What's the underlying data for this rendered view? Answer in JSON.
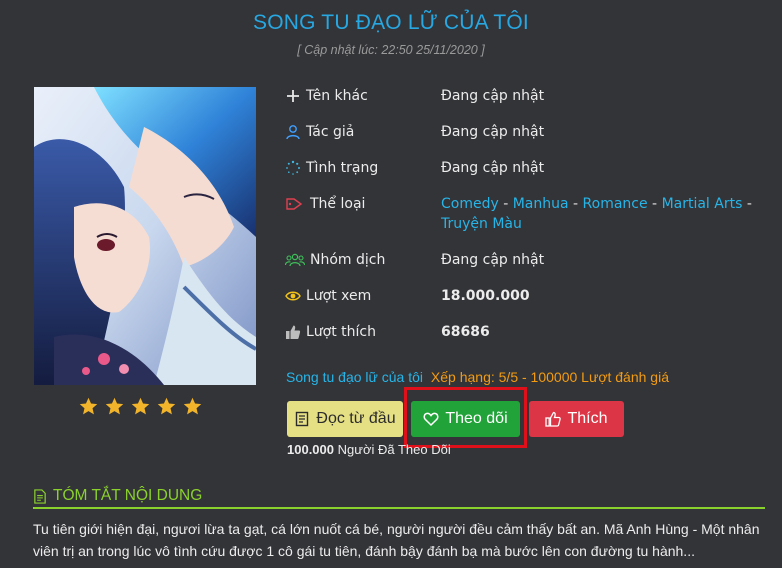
{
  "title": "SONG TU ĐẠO LỮ CỦA TÔI",
  "updated": "[ Cập nhật lúc: 22:50 25/11/2020 ]",
  "rating_stars": 5,
  "info": [
    {
      "icon": "plus-icon",
      "label": "Tên khác",
      "value": "Đang cập nhật"
    },
    {
      "icon": "user-icon",
      "label": "Tác giả",
      "value": "Đang cập nhật"
    },
    {
      "icon": "spinner-icon",
      "label": "Tình trạng",
      "value": "Đang cập nhật"
    },
    {
      "icon": "tag-icon",
      "label": "Thể loại"
    },
    {
      "icon": "group-icon",
      "label": "Nhóm dịch",
      "value": "Đang cập nhật"
    },
    {
      "icon": "eye-icon",
      "label": "Lượt xem",
      "value": "18.000.000"
    },
    {
      "icon": "thumbs-up-icon",
      "label": "Lượt thích",
      "value": "68686"
    }
  ],
  "genres": [
    "Comedy",
    "Manhua",
    "Romance",
    "Martial Arts",
    "Truyện Màu"
  ],
  "genre_separator": " - ",
  "rating": {
    "title_link": "Song tu đạo lữ của tôi",
    "rank_text": "Xếp hạng: 5/5 - 100000 Lượt đánh giá"
  },
  "buttons": {
    "read": "Đọc từ đầu",
    "follow": "Theo dõi",
    "like": "Thích"
  },
  "followers": {
    "count": "100.000",
    "label": "Người Đã Theo Dõi"
  },
  "summary": {
    "heading": "TÓM TẮT NỘI DUNG",
    "text": "Tu tiên giới hiện đại, ngươi lừa ta gạt, cá lớn nuốt cá bé, người người đều cảm thấy bất an. Mã Anh Hùng - Một nhân viên trị an trong lúc vô tình cứu được 1 cô gái tu tiên, đánh bậy đánh bạ mà bước lên con đường tu hành..."
  },
  "colors": {
    "background": "#333438",
    "title": "#27a8e2",
    "link": "#27b5e8",
    "rank": "#f39c12",
    "star": "#f2b42b",
    "read_button": "#e6e085",
    "follow_button": "#22a33a",
    "like_button": "#dc3545",
    "highlight": "#e0101a",
    "summary_accent": "#8bd12d"
  }
}
